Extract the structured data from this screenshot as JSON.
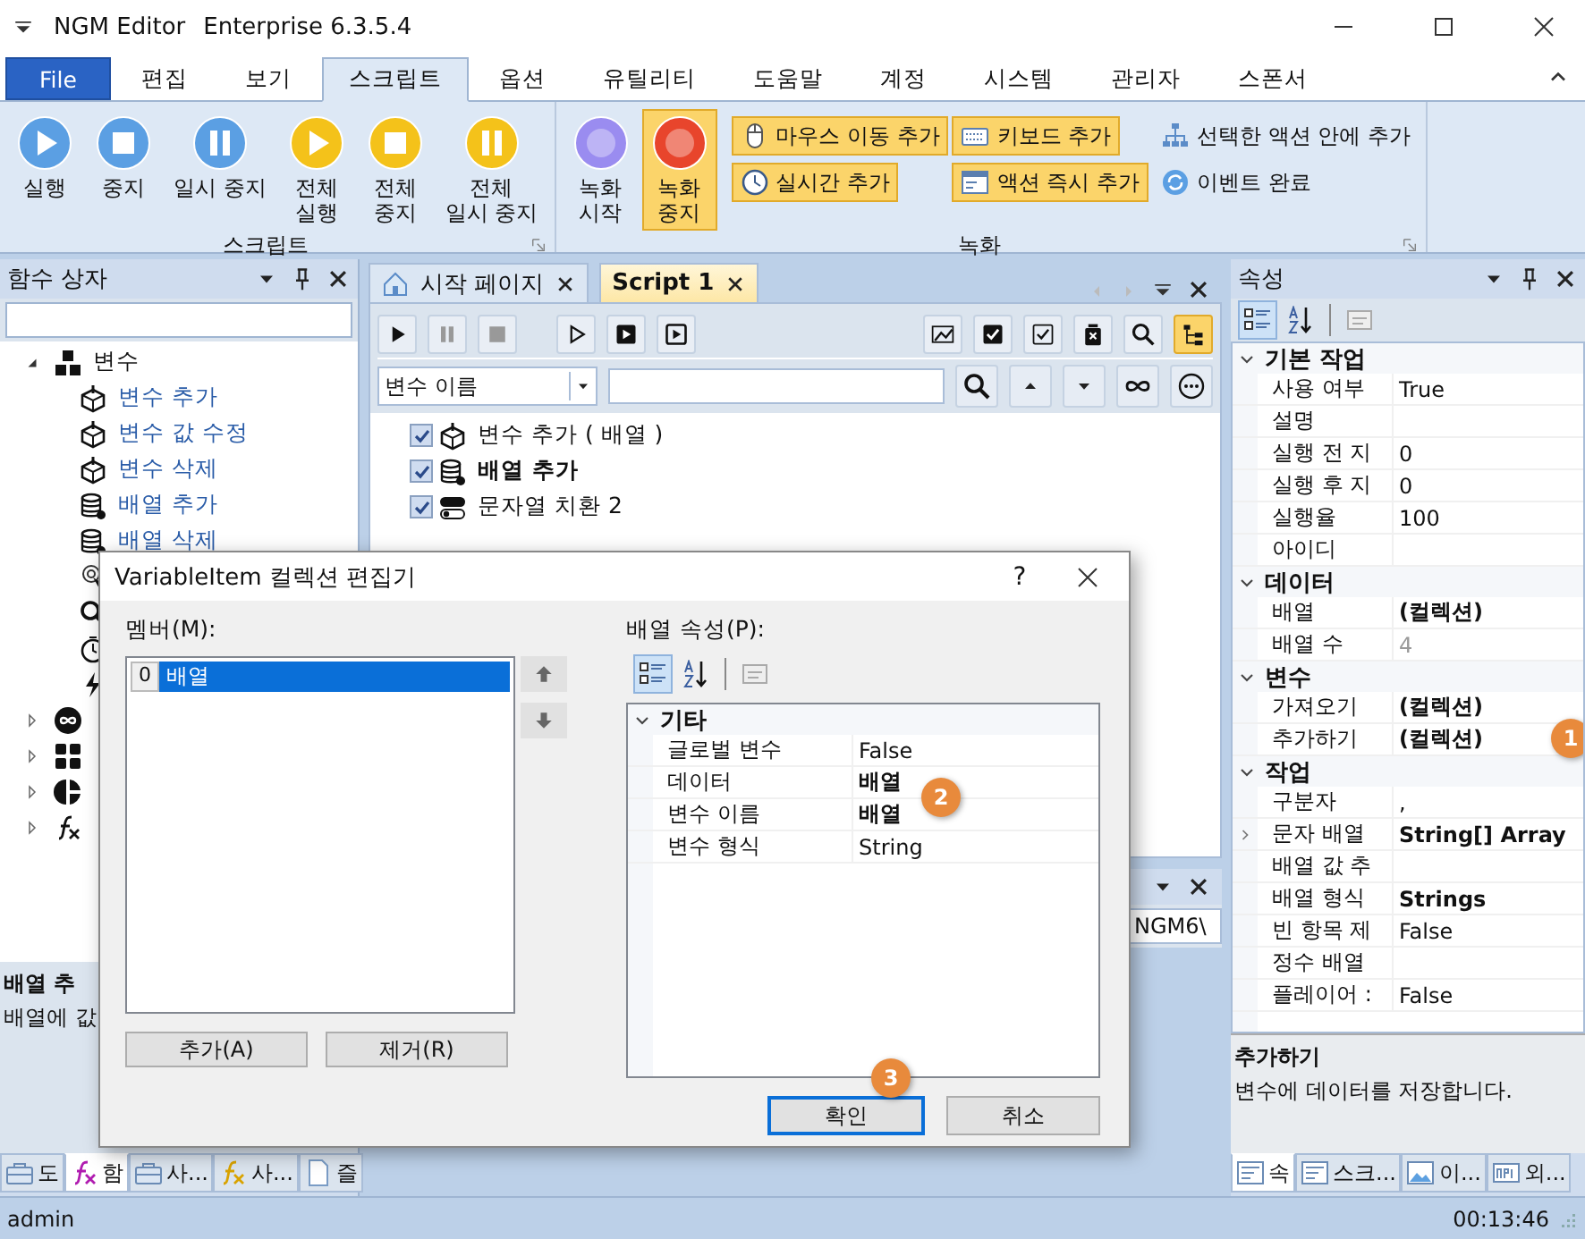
{
  "window": {
    "title": "NGM Editor",
    "edition": "Enterprise 6.3.5.4"
  },
  "menu_tabs": [
    {
      "label": "File",
      "kind": "file",
      "selected": false
    },
    {
      "label": "편집",
      "selected": false
    },
    {
      "label": "보기",
      "selected": false
    },
    {
      "label": "스크립트",
      "selected": true
    },
    {
      "label": "옵션",
      "selected": false
    },
    {
      "label": "유틸리티",
      "selected": false
    },
    {
      "label": "도움말",
      "selected": false
    },
    {
      "label": "계정",
      "selected": false
    },
    {
      "label": "시스템",
      "selected": false
    },
    {
      "label": "관리자",
      "selected": false
    },
    {
      "label": "스폰서",
      "selected": false
    }
  ],
  "ribbon": {
    "groups": [
      {
        "label": "스크립트",
        "buttons": [
          {
            "label": "실행",
            "kind": "play",
            "color": "#5b9fe3",
            "selected": false
          },
          {
            "label": "중지",
            "kind": "stop",
            "color": "#5b9fe3",
            "selected": false
          },
          {
            "label": "일시 중지",
            "kind": "pause",
            "color": "#5b9fe3",
            "selected": false
          },
          {
            "label": "전체\n실행",
            "kind": "play",
            "color": "#f4c21a",
            "selected": false
          },
          {
            "label": "전체\n중지",
            "kind": "stop",
            "color": "#f4c21a",
            "selected": false
          },
          {
            "label": "전체\n일시 중지",
            "kind": "pause",
            "color": "#f4c21a",
            "selected": false
          }
        ]
      },
      {
        "label": "녹화",
        "buttons": [
          {
            "label": "녹화\n시작",
            "kind": "record",
            "color": "#9a8cf0",
            "selected": false
          },
          {
            "label": "녹화\n중지",
            "kind": "record",
            "color": "#e8452c",
            "selected": true
          }
        ],
        "small_buttons": [
          {
            "label": "마우스 이동 추가",
            "kind": "mouse",
            "active": true
          },
          {
            "label": "키보드 추가",
            "kind": "keyboard",
            "active": true
          },
          {
            "label": "선택한 액션 안에 추가",
            "kind": "tree",
            "active": false
          },
          {
            "label": "실시간 추가",
            "kind": "clock",
            "active": true
          },
          {
            "label": "액션 즉시 추가",
            "kind": "window",
            "active": true
          },
          {
            "label": "이벤트 완료",
            "kind": "refresh",
            "active": false
          }
        ]
      }
    ]
  },
  "function_box": {
    "title": "함수 상자",
    "tree": [
      {
        "label": "변수",
        "kind": "blocks",
        "expanded": true,
        "children": [
          {
            "label": "변수 추가",
            "kind": "variable"
          },
          {
            "label": "변수 값 수정",
            "kind": "variable"
          },
          {
            "label": "변수 삭제",
            "kind": "variable"
          },
          {
            "label": "배열 추가",
            "kind": "array"
          },
          {
            "label": "배열 삭제",
            "kind": "array"
          },
          {
            "kind": "touch"
          },
          {
            "kind": "search"
          },
          {
            "kind": "timer"
          },
          {
            "kind": "bolt"
          }
        ]
      },
      {
        "kind": "loop",
        "expanded": false
      },
      {
        "kind": "grid",
        "expanded": false
      },
      {
        "kind": "pie",
        "expanded": false
      },
      {
        "kind": "fx",
        "expanded": false
      }
    ],
    "description": {
      "title": "배열 추",
      "text": "배열에 값"
    },
    "bottom_tabs": [
      {
        "label": "도",
        "kind": "toolbox",
        "selected": false
      },
      {
        "label": "함",
        "kind": "fx",
        "selected": true
      },
      {
        "label": "사...",
        "kind": "toolbox",
        "selected": false
      },
      {
        "label": "사...",
        "kind": "fx",
        "selected": false
      },
      {
        "label": "즐",
        "kind": "page",
        "selected": false
      }
    ]
  },
  "documents": {
    "tabs": [
      {
        "label": "시작 페이지",
        "kind": "home",
        "selected": false
      },
      {
        "label": "Script 1",
        "selected": true
      }
    ],
    "filter": {
      "value": "변수 이름"
    },
    "actions": [
      {
        "label": "변수 추가 ( 배열 )",
        "kind": "variable",
        "checked": true,
        "bold": false
      },
      {
        "label": "배열 추가",
        "kind": "array",
        "checked": true,
        "bold": true
      },
      {
        "label": "문자열 치환 2",
        "kind": "toggle",
        "checked": true,
        "bold": false
      }
    ],
    "output": {
      "value": "NGM6\\"
    }
  },
  "properties": {
    "title": "속성",
    "categories": [
      {
        "label": "기본 작업",
        "expanded": true,
        "rows": [
          {
            "name": "사용 여부",
            "value": "True"
          },
          {
            "name": "설명"
          },
          {
            "name": "실행 전 지",
            "value": "0"
          },
          {
            "name": "실행 후 지",
            "value": "0"
          },
          {
            "name": "실행율",
            "value": "100"
          },
          {
            "name": "아이디"
          }
        ]
      },
      {
        "label": "데이터",
        "expanded": true,
        "rows": [
          {
            "name": "배열",
            "value": "(컬렉션)",
            "bold": true
          },
          {
            "name": "배열 수",
            "value": "4",
            "disabled": true
          }
        ]
      },
      {
        "label": "변수",
        "expanded": true,
        "rows": [
          {
            "name": "가져오기",
            "value": "(컬렉션)",
            "bold": true
          },
          {
            "name": "추가하기",
            "value": "(컬렉션)",
            "bold": true,
            "badge": "1"
          }
        ]
      },
      {
        "label": "작업",
        "expanded": true,
        "rows": [
          {
            "name": "구분자",
            "value": ","
          },
          {
            "name": "문자 배열",
            "value": "String[] Array",
            "bold": true,
            "expanded": false
          },
          {
            "name": "배열 값 추"
          },
          {
            "name": "배열 형식",
            "value": "Strings",
            "bold": true
          },
          {
            "name": "빈 항목 제",
            "value": "False"
          },
          {
            "name": "정수 배열"
          },
          {
            "name": "플레이어 :",
            "value": "False"
          }
        ]
      }
    ],
    "description": {
      "title": "추가하기",
      "text": "변수에 데이터를 저장합니다."
    },
    "bottom_tabs": [
      {
        "label": "속",
        "kind": "props",
        "selected": true
      },
      {
        "label": "스크...",
        "kind": "props",
        "selected": false
      },
      {
        "label": "이...",
        "kind": "image",
        "selected": false
      },
      {
        "label": "외...",
        "kind": "api",
        "selected": false
      }
    ]
  },
  "dialog": {
    "title": "VariableItem 컬렉션 편집기",
    "help": "?",
    "members_label": "멤버(M):",
    "members": [
      {
        "index": "0",
        "label": "배열",
        "selected": true
      }
    ],
    "add_button": "추가(A)",
    "remove_button": "제거(R)",
    "props_label": "배열 속성(P):",
    "categories": [
      {
        "label": "기타",
        "expanded": true,
        "rows": [
          {
            "name": "글로벌 변수",
            "value": "False"
          },
          {
            "name": "데이터",
            "value": "배열",
            "bold": true
          },
          {
            "name": "변수 이름",
            "value": "배열",
            "bold": true,
            "badge": "2"
          },
          {
            "name": "변수 형식",
            "value": "String"
          }
        ]
      }
    ],
    "ok_button": {
      "label": "확인",
      "badge": "3"
    },
    "cancel_button": "취소"
  },
  "status_bar": {
    "user": "admin",
    "time": "00:13:46"
  }
}
